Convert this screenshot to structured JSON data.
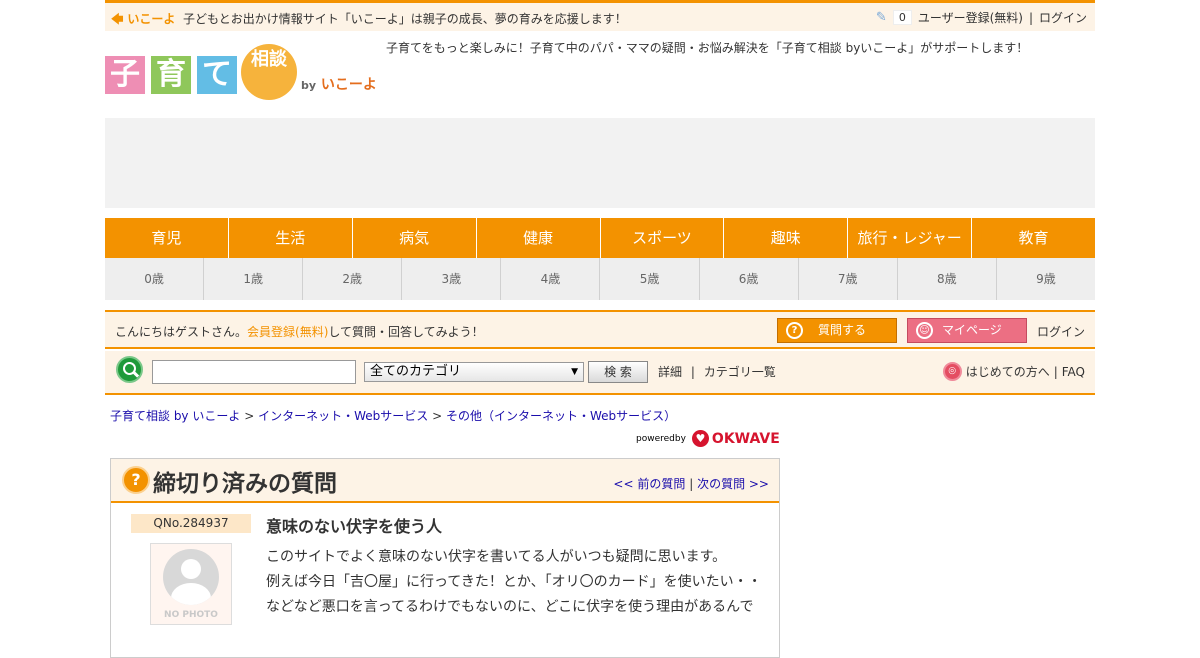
{
  "topbar": {
    "brand": "いこーよ",
    "tagline": "子どもとお出かけ情報サイト「いこーよ」は親子の成長、夢の育みを応援します！",
    "clip_count": "0",
    "register": "ユーザー登録(無料)",
    "separator": "|",
    "login": "ログイン"
  },
  "logo": {
    "chars": [
      "子",
      "育",
      "て"
    ],
    "circle": "相談",
    "by": "by",
    "brand": "いこーよ",
    "colors": [
      "#ee8eb4",
      "#8fc75b",
      "#63bde5",
      "#f6b33c"
    ]
  },
  "header_message": "子育てをもっと楽しみに！子育て中のパパ・ママの疑問・お悩み解決を「子育て相談 byいこーよ」がサポートします！",
  "categories": [
    "育児",
    "生活",
    "病気",
    "健康",
    "スポーツ",
    "趣味",
    "旅行・レジャー",
    "教育"
  ],
  "ages": [
    "0歳",
    "1歳",
    "2歳",
    "3歳",
    "4歳",
    "5歳",
    "6歳",
    "7歳",
    "8歳",
    "9歳"
  ],
  "guestbar": {
    "greeting_pre": "こんにちはゲストさん。",
    "register_link": "会員登録(無料)",
    "greeting_post": "して質問・回答してみよう！",
    "ask_button": "質問する",
    "mypage_button": "マイページ",
    "login": "ログイン"
  },
  "search": {
    "input_value": "",
    "category_selected": "全てのカテゴリ",
    "button": "検 索",
    "detail": "詳細",
    "separator": "|",
    "category_list": "カテゴリ一覧",
    "first_time": "はじめての方へ",
    "faq": "FAQ"
  },
  "breadcrumb": {
    "items": [
      "子育て相談 by いこーよ",
      "インターネット・Webサービス",
      "その他（インターネット・Webサービス）"
    ],
    "sep": ">"
  },
  "powered": {
    "label": "poweredby",
    "brand": "OKWAVE"
  },
  "question": {
    "panel_title": "締切り済みの質問",
    "prev": "<< 前の質問",
    "nav_sep": "|",
    "next": "次の質問 >>",
    "number": "QNo.284937",
    "avatar_label": "NO PHOTO",
    "title": "意味のない伏字を使う人",
    "body": [
      "このサイトでよく意味のない伏字を書いてる人がいつも疑問に思います。",
      "例えば今日「吉〇屋」に行ってきた！とか、「オリ〇のカード」を使いたい・・",
      "などなど悪口を言ってるわけでもないのに、どこに伏字を使う理由があるんで"
    ]
  }
}
